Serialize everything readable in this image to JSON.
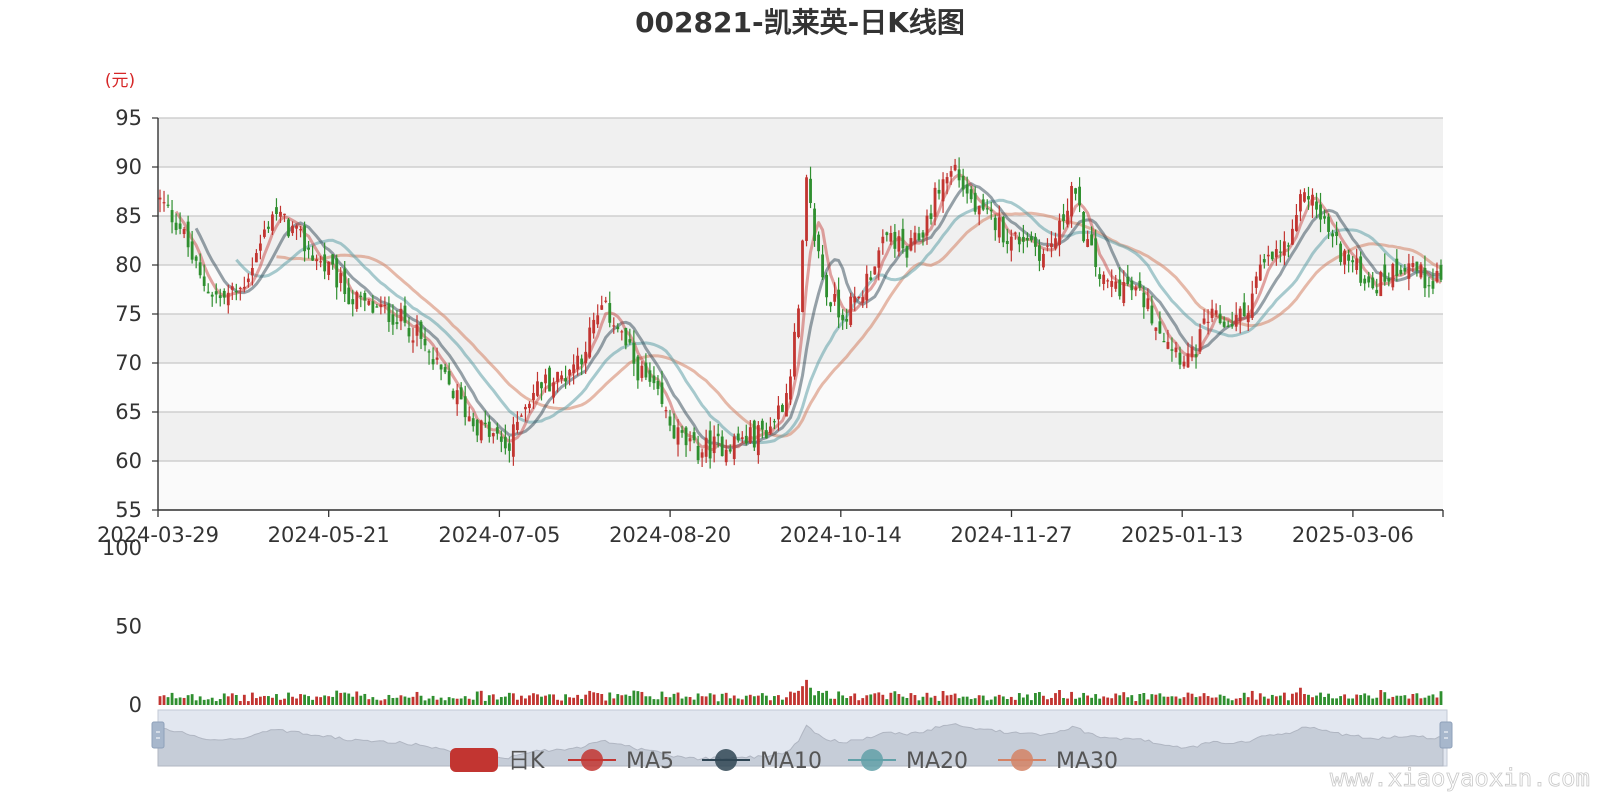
{
  "chart_data": {
    "type": "candlestick",
    "title": "002821-凯莱英-日K线图",
    "unit": "(元)",
    "price_axis": {
      "ylim": [
        55,
        95
      ],
      "ticks": [
        95,
        90,
        85,
        80,
        75,
        70,
        65,
        60,
        55
      ]
    },
    "volume_axis": {
      "ylim": [
        0,
        100
      ],
      "ticks": [
        100,
        50,
        0
      ]
    },
    "x_tick_labels": [
      "2024-03-29",
      "2024-05-21",
      "2024-07-05",
      "2024-08-20",
      "2024-10-14",
      "2024-11-27",
      "2025-01-13",
      "2025-03-06"
    ],
    "close_anchors": [
      [
        0,
        86.5
      ],
      [
        5,
        84
      ],
      [
        10,
        78.5
      ],
      [
        15,
        76.5
      ],
      [
        20,
        77.5
      ],
      [
        24,
        81
      ],
      [
        28,
        85.5
      ],
      [
        33,
        83.5
      ],
      [
        38,
        81
      ],
      [
        43,
        79
      ],
      [
        48,
        76.5
      ],
      [
        53,
        75.5
      ],
      [
        58,
        75
      ],
      [
        63,
        73.5
      ],
      [
        68,
        70
      ],
      [
        73,
        67
      ],
      [
        78,
        64
      ],
      [
        83,
        62.5
      ],
      [
        87,
        61.2
      ],
      [
        90,
        65.5
      ],
      [
        95,
        68
      ],
      [
        100,
        68.5
      ],
      [
        105,
        71
      ],
      [
        110,
        75.5
      ],
      [
        113,
        74.5
      ],
      [
        118,
        70
      ],
      [
        123,
        67
      ],
      [
        128,
        63
      ],
      [
        133,
        61
      ],
      [
        138,
        61.5
      ],
      [
        143,
        62
      ],
      [
        148,
        62.5
      ],
      [
        152,
        63.5
      ],
      [
        156,
        67
      ],
      [
        159,
        75
      ],
      [
        161,
        88
      ],
      [
        163,
        83
      ],
      [
        166,
        77
      ],
      [
        170,
        75
      ],
      [
        174,
        76.5
      ],
      [
        178,
        80.5
      ],
      [
        182,
        83
      ],
      [
        186,
        81
      ],
      [
        190,
        83.5
      ],
      [
        194,
        88
      ],
      [
        198,
        90
      ],
      [
        200,
        88
      ],
      [
        204,
        85
      ],
      [
        208,
        84.5
      ],
      [
        212,
        82.5
      ],
      [
        216,
        83
      ],
      [
        220,
        81
      ],
      [
        224,
        83.5
      ],
      [
        227,
        88
      ],
      [
        231,
        82
      ],
      [
        235,
        78
      ],
      [
        240,
        78
      ],
      [
        245,
        76.5
      ],
      [
        250,
        73
      ],
      [
        254,
        71
      ],
      [
        257,
        70.5
      ],
      [
        261,
        74.5
      ],
      [
        266,
        74
      ],
      [
        270,
        75
      ],
      [
        274,
        79.5
      ],
      [
        278,
        81
      ],
      [
        282,
        82.5
      ],
      [
        285,
        88
      ],
      [
        289,
        85
      ],
      [
        293,
        82
      ],
      [
        298,
        79.5
      ],
      [
        303,
        78
      ],
      [
        307,
        79.5
      ],
      [
        311,
        80.5
      ],
      [
        315,
        78.5
      ],
      [
        319,
        79
      ]
    ],
    "volume_range": [
      2,
      16
    ],
    "series": [
      {
        "name": "日K",
        "color": "#c23531"
      },
      {
        "name": "MA5",
        "color": "#c23531"
      },
      {
        "name": "MA10",
        "color": "#2f4554"
      },
      {
        "name": "MA20",
        "color": "#61a0a8"
      },
      {
        "name": "MA30",
        "color": "#d48265"
      }
    ],
    "up_color": "#c23531",
    "down_color": "#2f8f2f",
    "background_bands": [
      "#f0f0f0",
      "#fafafa"
    ]
  },
  "watermark": "www.xiaoyaoxin.com"
}
